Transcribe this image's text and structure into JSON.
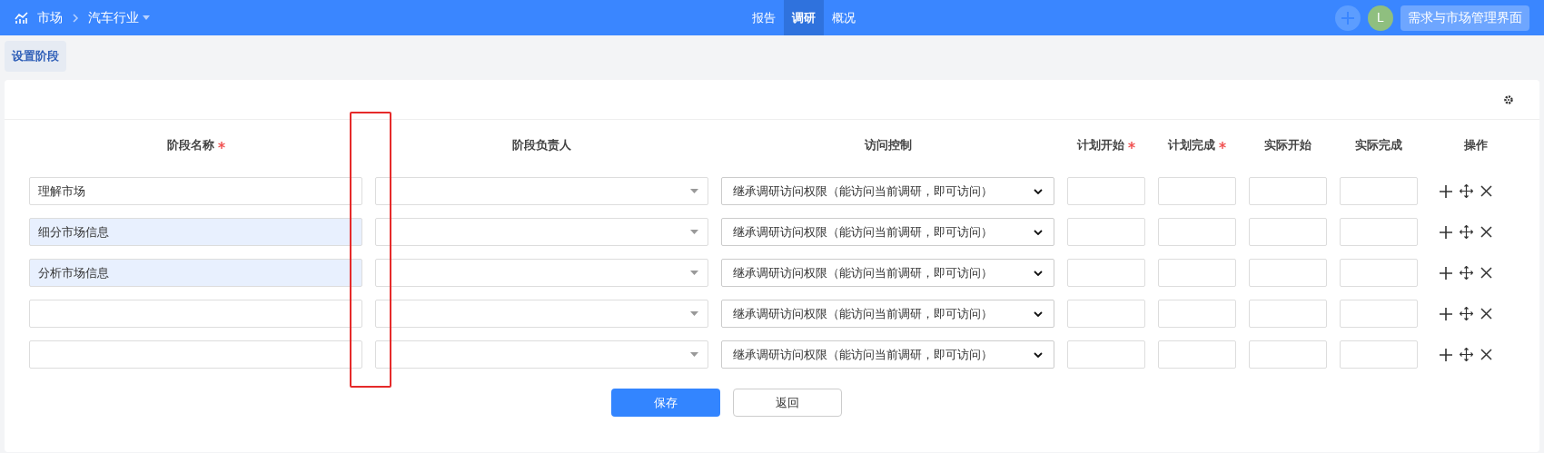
{
  "header": {
    "breadcrumb": [
      "市场",
      "汽车行业"
    ],
    "tabs": [
      {
        "label": "报告",
        "selected": false
      },
      {
        "label": "调研",
        "selected": true
      },
      {
        "label": "概况",
        "selected": false
      }
    ],
    "avatar": "L",
    "app_button": "需求与市场管理界面"
  },
  "page_tab": "设置阶段",
  "table": {
    "columns": [
      {
        "label": "阶段名称",
        "required": true
      },
      {
        "label": "阶段负责人",
        "required": false
      },
      {
        "label": "访问控制",
        "required": false
      },
      {
        "label": "计划开始",
        "required": true
      },
      {
        "label": "计划完成",
        "required": true
      },
      {
        "label": "实际开始",
        "required": false
      },
      {
        "label": "实际完成",
        "required": false
      },
      {
        "label": "操作",
        "required": false
      }
    ],
    "rows": [
      {
        "name": "理解市场",
        "highlighted": false,
        "access": "继承调研访问权限（能访问当前调研，即可访问）"
      },
      {
        "name": "细分市场信息",
        "highlighted": true,
        "access": "继承调研访问权限（能访问当前调研，即可访问）"
      },
      {
        "name": "分析市场信息",
        "highlighted": true,
        "access": "继承调研访问权限（能访问当前调研，即可访问）"
      },
      {
        "highlighted": false,
        "access": "继承调研访问权限（能访问当前调研，即可访问）"
      },
      {
        "highlighted": false,
        "access": "继承调研访问权限（能访问当前调研，即可访问）"
      }
    ]
  },
  "buttons": [
    {
      "label": "保存",
      "kind": "primary"
    },
    {
      "label": "返回",
      "kind": "secondary"
    }
  ]
}
